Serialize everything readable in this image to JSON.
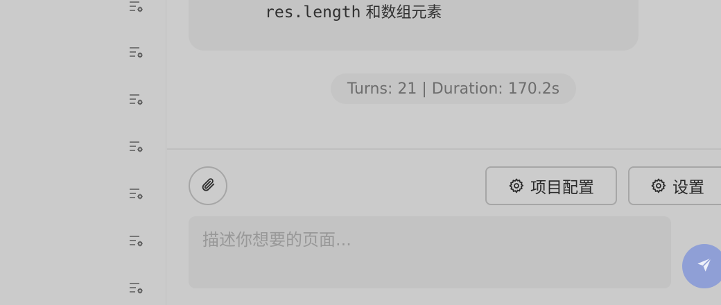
{
  "sidebar": {
    "items": [
      {
        "icon": "list-settings-icon"
      },
      {
        "icon": "list-settings-icon"
      },
      {
        "icon": "list-settings-icon"
      },
      {
        "icon": "list-settings-icon"
      },
      {
        "icon": "list-settings-icon"
      },
      {
        "icon": "list-settings-icon"
      },
      {
        "icon": "list-settings-icon"
      }
    ]
  },
  "chat": {
    "last_message": {
      "code": "res.length",
      "text": " 和数组元素"
    },
    "status": "Turns: 21 | Duration: 170.2s"
  },
  "input": {
    "attach_icon": "paperclip-icon",
    "project_config_label": "项目配置",
    "settings_label": "设置",
    "placeholder": "描述你想要的页面...",
    "value": "",
    "send_icon": "send-icon"
  },
  "colors": {
    "background": "#cbcbcb",
    "send_button": "#8f9fd6",
    "status_text": "#6d6d6d"
  }
}
